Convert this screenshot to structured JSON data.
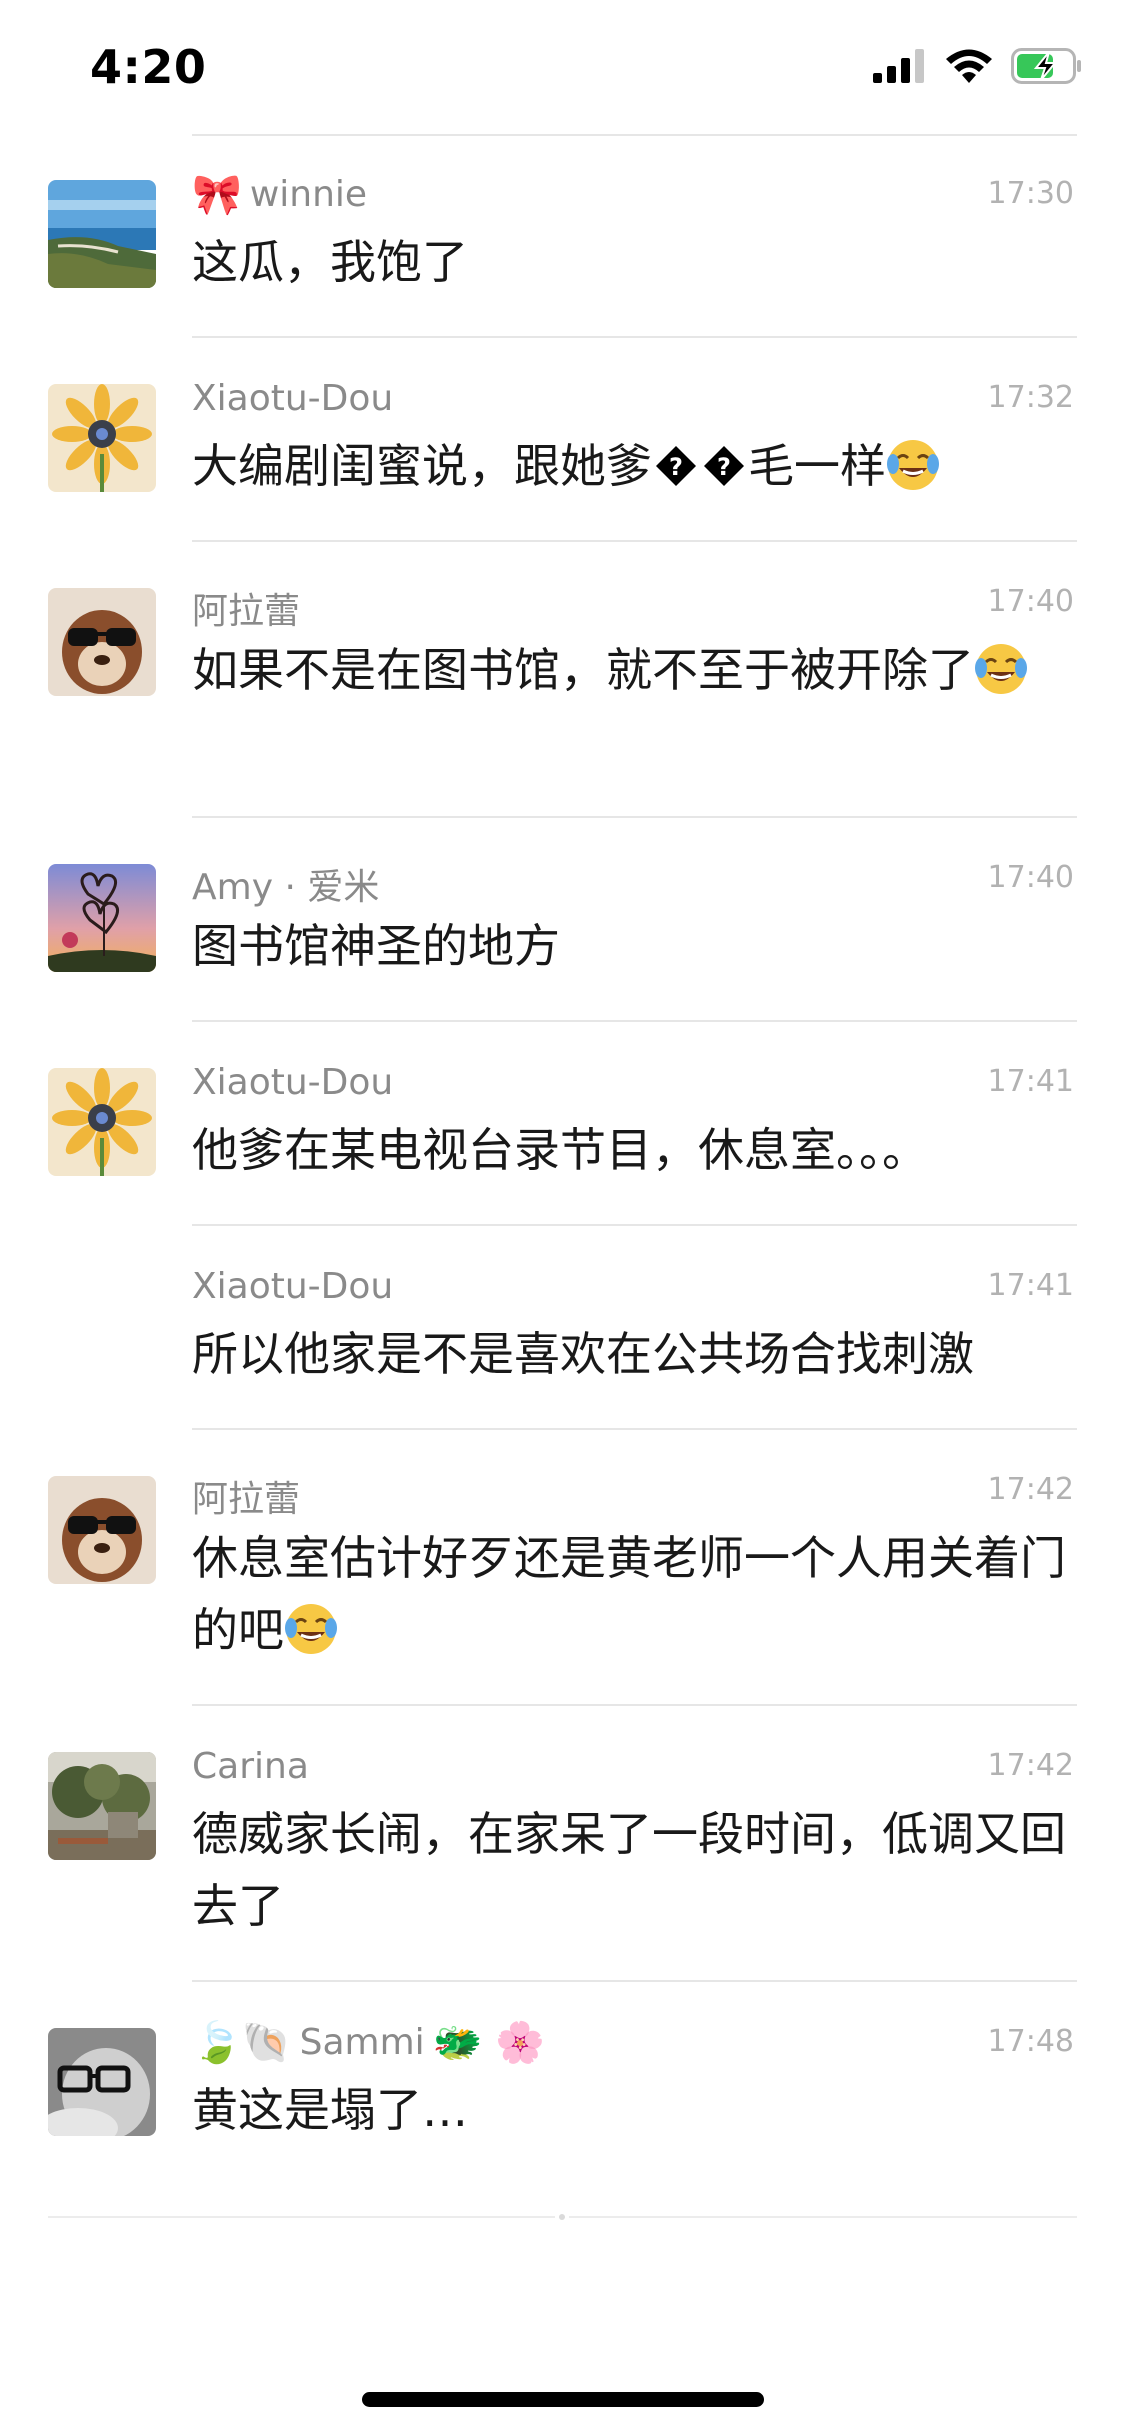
{
  "status_bar": {
    "time": "4:20"
  },
  "messages": [
    {
      "name_prefix": "🎀",
      "name": "winnie",
      "name_suffix": "",
      "time": "17:30",
      "text": "这瓜，我饱了",
      "emoji_after": ""
    },
    {
      "name_prefix": "",
      "name": "Xiaotu-Dou",
      "name_suffix": "",
      "time": "17:32",
      "text": "大编剧闺蜜说，跟她爹",
      "text_after_q": "毛一样",
      "emoji_after": "laugh"
    },
    {
      "name_prefix": "",
      "name": "阿拉蕾",
      "name_suffix": "",
      "time": "17:40",
      "text": "如果不是在图书馆，就不至于被开除了",
      "emoji_after": "laugh"
    },
    {
      "name_prefix": "",
      "name": "Amy · 爱米",
      "name_suffix": "",
      "time": "17:40",
      "text": "图书馆神圣的地方",
      "emoji_after": ""
    },
    {
      "name_prefix": "",
      "name": "Xiaotu-Dou",
      "name_suffix": "",
      "time": "17:41",
      "text": "他爹在某电视台录节目，休息室。。。",
      "emoji_after": ""
    },
    {
      "name_prefix": "",
      "name": "Xiaotu-Dou",
      "name_suffix": "",
      "time": "17:41",
      "text": "所以他家是不是喜欢在公共场合找刺激",
      "emoji_after": ""
    },
    {
      "name_prefix": "",
      "name": "阿拉蕾",
      "name_suffix": "",
      "time": "17:42",
      "text": "休息室估计好歹还是黄老师一个人用关着门的吧",
      "emoji_after": "laugh"
    },
    {
      "name_prefix": "",
      "name": "Carina",
      "name_suffix": "",
      "time": "17:42",
      "text": "德威家长闹，在家呆了一段时间，低调又回去了",
      "emoji_after": ""
    },
    {
      "name_prefix": "🍃🐚",
      "name": "Sammi",
      "name_suffix": "🐲 🌸",
      "time": "17:48",
      "text": "黄这是塌了…",
      "emoji_after": ""
    }
  ],
  "colors": {
    "name": "#8a8a8a",
    "time": "#b2b2b2",
    "text": "#191919",
    "divider": "#e6e6e6"
  },
  "icons": {
    "status": [
      "signal-icon",
      "wifi-icon",
      "battery-charging-icon"
    ],
    "emoji": "face-with-tears-of-joy-icon",
    "unknown_char": "replacement-char-icon"
  }
}
